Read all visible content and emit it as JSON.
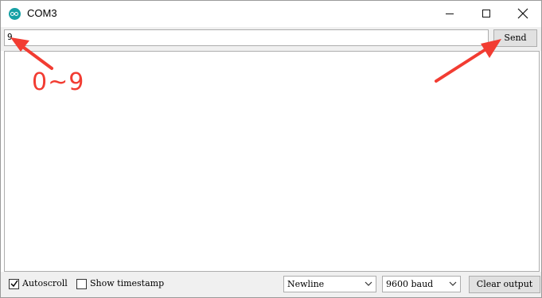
{
  "window": {
    "title": "COM3",
    "app_icon": "arduino-icon",
    "controls": [
      "minimize-icon",
      "maximize-icon",
      "close-icon"
    ]
  },
  "input": {
    "value": "9",
    "send_label": "Send"
  },
  "output": {
    "text": ""
  },
  "bottom": {
    "autoscroll_label": "Autoscroll",
    "autoscroll_checked": true,
    "timestamp_label": "Show timestamp",
    "timestamp_checked": false,
    "line_ending": "Newline",
    "baud": "9600 baud",
    "clear_label": "Clear output"
  },
  "annotation": {
    "range_text": "0~9",
    "color": "#f23c32"
  },
  "colors": {
    "accent": "#17a1a5",
    "bar_bg": "#f0f0f0",
    "button_bg": "#e1e1e1"
  }
}
